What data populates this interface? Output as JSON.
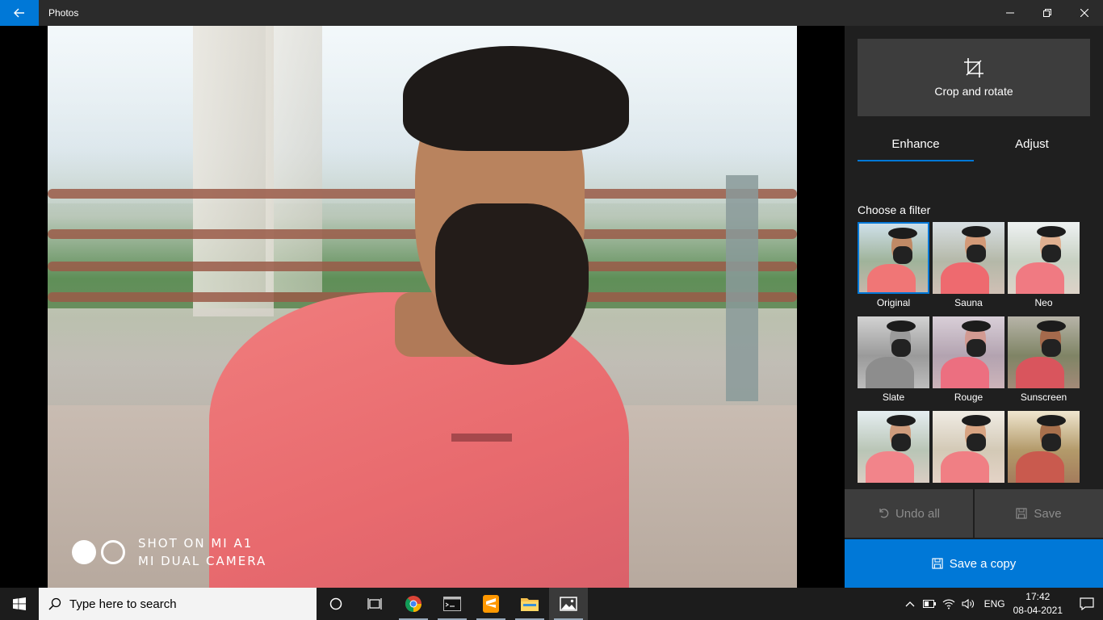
{
  "window": {
    "title": "Photos"
  },
  "photo": {
    "watermark_line1": "SHOT ON MI A1",
    "watermark_line2": "MI DUAL CAMERA"
  },
  "panel": {
    "crop_label": "Crop and rotate",
    "tabs": [
      {
        "label": "Enhance",
        "active": true
      },
      {
        "label": "Adjust",
        "active": false
      }
    ],
    "filter_heading": "Choose a filter",
    "filters": [
      {
        "label": "Original",
        "selected": true
      },
      {
        "label": "Sauna",
        "selected": false
      },
      {
        "label": "Neo",
        "selected": false
      },
      {
        "label": "Slate",
        "selected": false
      },
      {
        "label": "Rouge",
        "selected": false
      },
      {
        "label": "Sunscreen",
        "selected": false
      },
      {
        "label": "",
        "selected": false
      },
      {
        "label": "",
        "selected": false
      },
      {
        "label": "",
        "selected": false
      }
    ],
    "undo_all_label": "Undo all",
    "save_label": "Save",
    "save_copy_label": "Save a copy"
  },
  "taskbar": {
    "search_placeholder": "Type here to search",
    "language": "ENG",
    "time": "17:42",
    "date": "08-04-2021"
  },
  "colors": {
    "accent": "#0078d7",
    "titlebar": "#2b2b2b",
    "panel": "#1f1f1f",
    "button": "#3d3d3d"
  }
}
